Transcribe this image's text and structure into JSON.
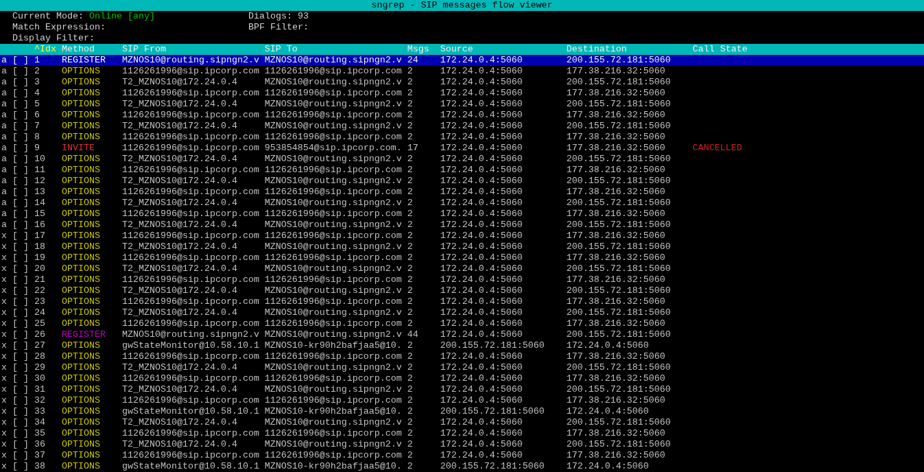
{
  "title_bar": {
    "title": "sngrep - SIP messages flow viewer"
  },
  "info": [
    {
      "label": "Current Mode:",
      "value": "Online [any]"
    },
    {
      "label": "Dialogs:",
      "value": "93"
    },
    {
      "label": "Match Expression:"
    },
    {
      "label": "BPF Filter:"
    },
    {
      "label": "Display Filter:"
    }
  ],
  "table": {
    "columns": [
      {
        "label": "^Idx",
        "sorted": true
      },
      {
        "label": "Method",
        "sorted": false
      },
      {
        "label": "SIP From",
        "sorted": false
      },
      {
        "label": "SIP To",
        "sorted": false
      },
      {
        "label": "Msgs",
        "sorted": false
      },
      {
        "label": "Source",
        "sorted": false
      },
      {
        "label": "Destination",
        "sorted": false
      },
      {
        "label": "Call State",
        "sorted": false
      }
    ],
    "rows": [
      {
        "status": "a",
        "mark": "[ ]",
        "idx": "1",
        "method": "REGISTER",
        "color": "#ffffff",
        "from": "MZNOS10@routing.sipngn2.v",
        "to": "MZNOS10@routing.sipngn2.v",
        "msgs": "24",
        "source": "172.24.0.4:5060",
        "destination": "200.155.72.181:5060",
        "selected": true
      },
      {
        "status": "a",
        "mark": "[ ]",
        "idx": "2",
        "method": "OPTIONS",
        "color": "#c8c800",
        "from": "1126261996@sip.ipcorp.com",
        "to": "1126261996@sip.ipcorp.com",
        "msgs": "2",
        "source": "172.24.0.4:5060",
        "destination": "177.38.216.32:5060",
        "selected": false
      },
      {
        "status": "a",
        "mark": "[ ]",
        "idx": "3",
        "method": "OPTIONS",
        "color": "#c8c800",
        "from": "T2_MZNOS10@172.24.0.4",
        "to": "MZNOS10@routing.sipngn2.v",
        "msgs": "2",
        "source": "172.24.0.4:5060",
        "destination": "200.155.72.181:5060",
        "selected": false
      },
      {
        "status": "a",
        "mark": "[ ]",
        "idx": "4",
        "method": "OPTIONS",
        "color": "#c8c800",
        "from": "1126261996@sip.ipcorp.com",
        "to": "1126261996@sip.ipcorp.com",
        "msgs": "2",
        "source": "172.24.0.4:5060",
        "destination": "177.38.216.32:5060",
        "selected": false
      },
      {
        "status": "a",
        "mark": "[ ]",
        "idx": "5",
        "method": "OPTIONS",
        "color": "#c8c800",
        "from": "T2_MZNOS10@172.24.0.4",
        "to": "MZNOS10@routing.sipngn2.v",
        "msgs": "2",
        "source": "172.24.0.4:5060",
        "destination": "200.155.72.181:5060",
        "selected": false
      },
      {
        "status": "a",
        "mark": "[ ]",
        "idx": "6",
        "method": "OPTIONS",
        "color": "#c8c800",
        "from": "1126261996@sip.ipcorp.com",
        "to": "1126261996@sip.ipcorp.com",
        "msgs": "2",
        "source": "172.24.0.4:5060",
        "destination": "177.38.216.32:5060",
        "selected": false
      },
      {
        "status": "a",
        "mark": "[ ]",
        "idx": "7",
        "method": "OPTIONS",
        "color": "#c8c800",
        "from": "T2_MZNOS10@172.24.0.4",
        "to": "MZNOS10@routing.sipngn2.v",
        "msgs": "2",
        "source": "172.24.0.4:5060",
        "destination": "200.155.72.181:5060",
        "selected": false
      },
      {
        "status": "a",
        "mark": "[ ]",
        "idx": "8",
        "method": "OPTIONS",
        "color": "#c8c800",
        "from": "1126261996@sip.ipcorp.com",
        "to": "1126261996@sip.ipcorp.com",
        "msgs": "2",
        "source": "172.24.0.4:5060",
        "destination": "177.38.216.32:5060",
        "selected": false
      },
      {
        "status": "a",
        "mark": "[ ]",
        "idx": "9",
        "method": "INVITE",
        "color": "#e03030",
        "from": "1126261996@sip.ipcorp.com",
        "to": "953854854@sip.ipcorp.com.",
        "msgs": "17",
        "source": "172.24.0.4:5060",
        "destination": "177.38.216.32:5060",
        "state": "CANCELLED",
        "selected": false
      },
      {
        "status": "a",
        "mark": "[ ]",
        "idx": "10",
        "method": "OPTIONS",
        "color": "#c8c800",
        "from": "T2_MZNOS10@172.24.0.4",
        "to": "MZNOS10@routing.sipngn2.v",
        "msgs": "2",
        "source": "172.24.0.4:5060",
        "destination": "200.155.72.181:5060",
        "selected": false
      },
      {
        "status": "a",
        "mark": "[ ]",
        "idx": "11",
        "method": "OPTIONS",
        "color": "#c8c800",
        "from": "1126261996@sip.ipcorp.com",
        "to": "1126261996@sip.ipcorp.com",
        "msgs": "2",
        "source": "172.24.0.4:5060",
        "destination": "177.38.216.32:5060",
        "selected": false
      },
      {
        "status": "a",
        "mark": "[ ]",
        "idx": "12",
        "method": "OPTIONS",
        "color": "#c8c800",
        "from": "T2_MZNOS10@172.24.0.4",
        "to": "MZNOS10@routing.sipngn2.v",
        "msgs": "2",
        "source": "172.24.0.4:5060",
        "destination": "200.155.72.181:5060",
        "selected": false
      },
      {
        "status": "a",
        "mark": "[ ]",
        "idx": "13",
        "method": "OPTIONS",
        "color": "#c8c800",
        "from": "1126261996@sip.ipcorp.com",
        "to": "1126261996@sip.ipcorp.com",
        "msgs": "2",
        "source": "172.24.0.4:5060",
        "destination": "177.38.216.32:5060",
        "selected": false
      },
      {
        "status": "a",
        "mark": "[ ]",
        "idx": "14",
        "method": "OPTIONS",
        "color": "#c8c800",
        "from": "T2_MZNOS10@172.24.0.4",
        "to": "MZNOS10@routing.sipngn2.v",
        "msgs": "2",
        "source": "172.24.0.4:5060",
        "destination": "200.155.72.181:5060",
        "selected": false
      },
      {
        "status": "a",
        "mark": "[ ]",
        "idx": "15",
        "method": "OPTIONS",
        "color": "#c8c800",
        "from": "1126261996@sip.ipcorp.com",
        "to": "1126261996@sip.ipcorp.com",
        "msgs": "2",
        "source": "172.24.0.4:5060",
        "destination": "177.38.216.32:5060",
        "selected": false
      },
      {
        "status": "a",
        "mark": "[ ]",
        "idx": "16",
        "method": "OPTIONS",
        "color": "#c8c800",
        "from": "T2_MZNOS10@172.24.0.4",
        "to": "MZNOS10@routing.sipngn2.v",
        "msgs": "2",
        "source": "172.24.0.4:5060",
        "destination": "200.155.72.181:5060",
        "selected": false
      },
      {
        "status": "x",
        "mark": "[ ]",
        "idx": "17",
        "method": "OPTIONS",
        "color": "#c8c800",
        "from": "1126261996@sip.ipcorp.com",
        "to": "1126261996@sip.ipcorp.com",
        "msgs": "2",
        "source": "172.24.0.4:5060",
        "destination": "177.38.216.32:5060",
        "selected": false
      },
      {
        "status": "x",
        "mark": "[ ]",
        "idx": "18",
        "method": "OPTIONS",
        "color": "#c8c800",
        "from": "T2_MZNOS10@172.24.0.4",
        "to": "MZNOS10@routing.sipngn2.v",
        "msgs": "2",
        "source": "172.24.0.4:5060",
        "destination": "200.155.72.181:5060",
        "selected": false
      },
      {
        "status": "x",
        "mark": "[ ]",
        "idx": "19",
        "method": "OPTIONS",
        "color": "#c8c800",
        "from": "1126261996@sip.ipcorp.com",
        "to": "1126261996@sip.ipcorp.com",
        "msgs": "2",
        "source": "172.24.0.4:5060",
        "destination": "177.38.216.32:5060",
        "selected": false
      },
      {
        "status": "x",
        "mark": "[ ]",
        "idx": "20",
        "method": "OPTIONS",
        "color": "#c8c800",
        "from": "T2_MZNOS10@172.24.0.4",
        "to": "MZNOS10@routing.sipngn2.v",
        "msgs": "2",
        "source": "172.24.0.4:5060",
        "destination": "200.155.72.181:5060",
        "selected": false
      },
      {
        "status": "x",
        "mark": "[ ]",
        "idx": "21",
        "method": "OPTIONS",
        "color": "#c8c800",
        "from": "1126261996@sip.ipcorp.com",
        "to": "1126261996@sip.ipcorp.com",
        "msgs": "2",
        "source": "172.24.0.4:5060",
        "destination": "177.38.216.32:5060",
        "selected": false
      },
      {
        "status": "x",
        "mark": "[ ]",
        "idx": "22",
        "method": "OPTIONS",
        "color": "#c8c800",
        "from": "T2_MZNOS10@172.24.0.4",
        "to": "MZNOS10@routing.sipngn2.v",
        "msgs": "2",
        "source": "172.24.0.4:5060",
        "destination": "200.155.72.181:5060",
        "selected": false
      },
      {
        "status": "x",
        "mark": "[ ]",
        "idx": "23",
        "method": "OPTIONS",
        "color": "#c8c800",
        "from": "1126261996@sip.ipcorp.com",
        "to": "1126261996@sip.ipcorp.com",
        "msgs": "2",
        "source": "172.24.0.4:5060",
        "destination": "177.38.216.32:5060",
        "selected": false
      },
      {
        "status": "x",
        "mark": "[ ]",
        "idx": "24",
        "method": "OPTIONS",
        "color": "#c8c800",
        "from": "T2_MZNOS10@172.24.0.4",
        "to": "MZNOS10@routing.sipngn2.v",
        "msgs": "2",
        "source": "172.24.0.4:5060",
        "destination": "200.155.72.181:5060",
        "selected": false
      },
      {
        "status": "x",
        "mark": "[ ]",
        "idx": "25",
        "method": "OPTIONS",
        "color": "#c8c800",
        "from": "1126261996@sip.ipcorp.com",
        "to": "1126261996@sip.ipcorp.com",
        "msgs": "2",
        "source": "172.24.0.4:5060",
        "destination": "177.38.216.32:5060",
        "selected": false
      },
      {
        "status": "x",
        "mark": "[ ]",
        "idx": "26",
        "method": "REGISTER",
        "color": "#c000c0",
        "from": "MZNOS10@routing.sipngn2.v",
        "to": "MZNOS10@routing.sipngn2.v",
        "msgs": "44",
        "source": "172.24.0.4:5060",
        "destination": "200.155.72.181:5060",
        "selected": false
      },
      {
        "status": "x",
        "mark": "[ ]",
        "idx": "27",
        "method": "OPTIONS",
        "color": "#c8c800",
        "from": "gwStateMonitor@10.58.10.1",
        "to": "MZNOS10-kr90h2bafjaa5@10.",
        "msgs": "2",
        "source": "200.155.72.181:5060",
        "destination": "172.24.0.4:5060",
        "selected": false
      },
      {
        "status": "x",
        "mark": "[ ]",
        "idx": "28",
        "method": "OPTIONS",
        "color": "#c8c800",
        "from": "1126261996@sip.ipcorp.com",
        "to": "1126261996@sip.ipcorp.com",
        "msgs": "2",
        "source": "172.24.0.4:5060",
        "destination": "177.38.216.32:5060",
        "selected": false
      },
      {
        "status": "x",
        "mark": "[ ]",
        "idx": "29",
        "method": "OPTIONS",
        "color": "#c8c800",
        "from": "T2_MZNOS10@172.24.0.4",
        "to": "MZNOS10@routing.sipngn2.v",
        "msgs": "2",
        "source": "172.24.0.4:5060",
        "destination": "200.155.72.181:5060",
        "selected": false
      },
      {
        "status": "x",
        "mark": "[ ]",
        "idx": "30",
        "method": "OPTIONS",
        "color": "#c8c800",
        "from": "1126261996@sip.ipcorp.com",
        "to": "1126261996@sip.ipcorp.com",
        "msgs": "2",
        "source": "172.24.0.4:5060",
        "destination": "177.38.216.32:5060",
        "selected": false
      },
      {
        "status": "x",
        "mark": "[ ]",
        "idx": "31",
        "method": "OPTIONS",
        "color": "#c8c800",
        "from": "T2_MZNOS10@172.24.0.4",
        "to": "MZNOS10@routing.sipngn2.v",
        "msgs": "2",
        "source": "172.24.0.4:5060",
        "destination": "200.155.72.181:5060",
        "selected": false
      },
      {
        "status": "x",
        "mark": "[ ]",
        "idx": "32",
        "method": "OPTIONS",
        "color": "#c8c800",
        "from": "1126261996@sip.ipcorp.com",
        "to": "1126261996@sip.ipcorp.com",
        "msgs": "2",
        "source": "172.24.0.4:5060",
        "destination": "177.38.216.32:5060",
        "selected": false
      },
      {
        "status": "x",
        "mark": "[ ]",
        "idx": "33",
        "method": "OPTIONS",
        "color": "#c8c800",
        "from": "gwStateMonitor@10.58.10.1",
        "to": "MZNOS10-kr90h2bafjaa5@10.",
        "msgs": "2",
        "source": "200.155.72.181:5060",
        "destination": "172.24.0.4:5060",
        "selected": false
      },
      {
        "status": "x",
        "mark": "[ ]",
        "idx": "34",
        "method": "OPTIONS",
        "color": "#c8c800",
        "from": "T2_MZNOS10@172.24.0.4",
        "to": "MZNOS10@routing.sipngn2.v",
        "msgs": "2",
        "source": "172.24.0.4:5060",
        "destination": "200.155.72.181:5060",
        "selected": false
      },
      {
        "status": "x",
        "mark": "[ ]",
        "idx": "35",
        "method": "OPTIONS",
        "color": "#c8c800",
        "from": "1126261996@sip.ipcorp.com",
        "to": "1126261996@sip.ipcorp.com",
        "msgs": "2",
        "source": "172.24.0.4:5060",
        "destination": "177.38.216.32:5060",
        "selected": false
      },
      {
        "status": "x",
        "mark": "[ ]",
        "idx": "36",
        "method": "OPTIONS",
        "color": "#c8c800",
        "from": "T2_MZNOS10@172.24.0.4",
        "to": "MZNOS10@routing.sipngn2.v",
        "msgs": "2",
        "source": "172.24.0.4:5060",
        "destination": "200.155.72.181:5060",
        "selected": false
      },
      {
        "status": "x",
        "mark": "[ ]",
        "idx": "37",
        "method": "OPTIONS",
        "color": "#c8c800",
        "from": "1126261996@sip.ipcorp.com",
        "to": "1126261996@sip.ipcorp.com",
        "msgs": "2",
        "source": "172.24.0.4:5060",
        "destination": "177.38.216.32:5060",
        "selected": false
      },
      {
        "status": "x",
        "mark": "[ ]",
        "idx": "38",
        "method": "OPTIONS",
        "color": "#c8c800",
        "from": "gwStateMonitor@10.58.10.1",
        "to": "MZNOS10-kr90h2bafjaa5@10.",
        "msgs": "2",
        "source": "200.155.72.181:5060",
        "destination": "172.24.0.4:5060",
        "selected": false
      }
    ]
  }
}
